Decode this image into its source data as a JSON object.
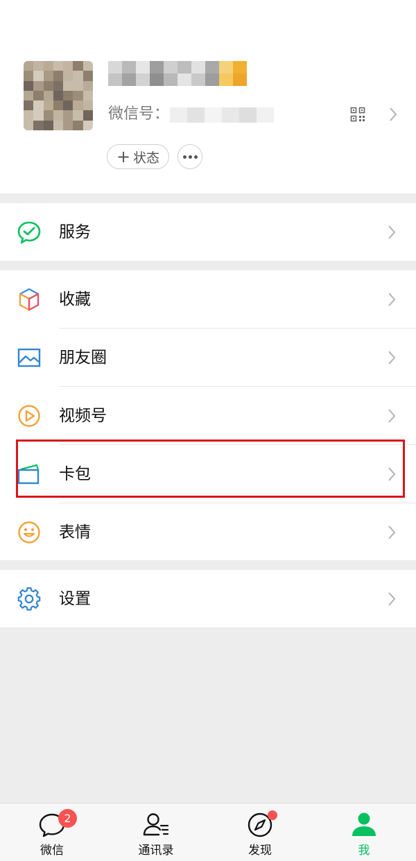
{
  "profile": {
    "wechat_id_label": "微信号：",
    "status_button": "状态"
  },
  "menu": {
    "services": "服务",
    "favorites": "收藏",
    "moments": "朋友圈",
    "channels": "视频号",
    "cards": "卡包",
    "stickers": "表情",
    "settings": "设置"
  },
  "tabbar": {
    "chats": "微信",
    "chats_badge": "2",
    "contacts": "通讯录",
    "discover": "发现",
    "me": "我"
  },
  "colors": {
    "accent_green": "#07c160",
    "badge_red": "#fa5151",
    "highlight_red": "#d9151b",
    "page_bg": "#ededed"
  }
}
